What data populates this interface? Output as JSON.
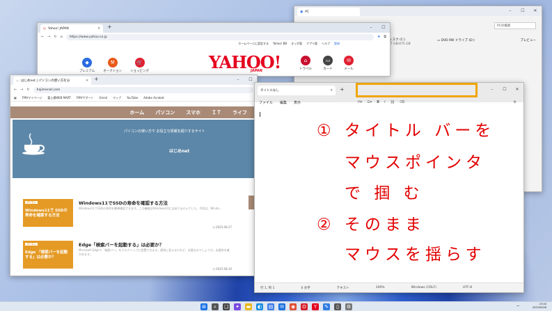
{
  "explorer": {
    "tab": "PC",
    "search_placeholder": "PCの検索",
    "preview": "プレビュー",
    "disk": "ディスク (C:)",
    "disk_free": "197 GB/475 GB",
    "dvd": "DVD RW ドライブ (D:)"
  },
  "yahoo": {
    "tab": "Yahoo! JAPAN",
    "url": "https://www.yahoo.co.jp",
    "top_links": [
      "ホームページに設定する",
      "Yahoo! BB",
      "きっず版",
      "アプリ版",
      "ヘルプ"
    ],
    "signin": "登録",
    "logo": "YAHOO!",
    "logo_sub": "JAPAN",
    "icons": [
      {
        "label": "プレミアム",
        "color": "#2a6be0",
        "icon": "diamond-icon"
      },
      {
        "label": "オークション",
        "color": "#e85a1a",
        "icon": "hammer-icon"
      },
      {
        "label": "ショッピング",
        "color": "#e02030",
        "icon": "cart-icon"
      }
    ],
    "icons_right": [
      {
        "label": "トラベル",
        "color": "#c8102e",
        "icon": "hotel-icon"
      },
      {
        "label": "カード",
        "color": "#444444",
        "icon": "card-icon"
      },
      {
        "label": "メール",
        "color": "#e02030",
        "icon": "mail-icon"
      }
    ]
  },
  "hajime": {
    "tab": "はじめnet | パソコンの使い方を分",
    "url": "hajimenet.com",
    "bookmarks": [
      "FMVマイページ",
      "富士通WEB MART",
      "FMVサポート",
      "Gmail",
      "マップ",
      "YouTube",
      "Adobe Acrobat"
    ],
    "nav": [
      "ホーム",
      "パソコン",
      "スマホ",
      "ＩＴ",
      "ライフ"
    ],
    "tagline": "パソコンの使い方や お役立ち情報を紹介するサイト",
    "site_name": "はじめnet",
    "posts": [
      {
        "badge": "パソコン",
        "thumb": "Windows11で SSDの寿命を確認する方法",
        "title": "Windows11でSSDの寿命を確認する方法",
        "desc": "Windows11でSSDの寿命を簡単確認できます。この機能はWindows10にはありませんでした。今回は、Windo…",
        "date": "2025.08.27"
      },
      {
        "badge": "パソコン",
        "thumb": "Edge 「検索バーを起動する」は必要か？",
        "title": "Edge「検索バーを起動する」は必要か？",
        "desc": "Microsoft Edgeで「検索バー」をデスクトップに設置できます。便利に見えるけれど、必要なのでしょうか。必要性を確かめます。",
        "date": "2025.08.10"
      }
    ]
  },
  "notepad": {
    "tab": "タイトルなし",
    "menus": [
      "ファイル",
      "編集",
      "表示"
    ],
    "status": [
      "行 1, 列 1",
      "0 文字",
      "テキスト",
      "100%",
      "Windows (CRLF)",
      "UTF-8"
    ]
  },
  "instructions": [
    "① タイトル バーを",
    "マウスポインタ",
    "で 掴 む",
    "② そのまま",
    "マウスを揺らす"
  ],
  "colors": {
    "instruction": "#e20000",
    "highlight": "#f0a500"
  },
  "taskbar": {
    "icons": [
      {
        "icon": "windows-icon",
        "color": "#1a73e8"
      },
      {
        "icon": "search-icon",
        "color": "#555555"
      },
      {
        "icon": "taskview-icon",
        "color": "#444444"
      },
      {
        "icon": "copilot-icon",
        "color": "#7a4ae0"
      },
      {
        "icon": "explorer-icon",
        "color": "#e8b923"
      },
      {
        "icon": "edge-icon",
        "color": "#1a8fe0"
      },
      {
        "icon": "store-icon",
        "color": "#3b7be8"
      },
      {
        "icon": "mail-icon",
        "color": "#1a6ee0"
      },
      {
        "icon": "chrome-icon",
        "color": "#e04a2f"
      },
      {
        "icon": "opera-icon",
        "color": "#d61f2c"
      },
      {
        "icon": "yahoo-icon",
        "color": "#e5001e"
      },
      {
        "icon": "notepad-icon",
        "color": "#2f7de1"
      },
      {
        "icon": "phone-icon",
        "color": "#555555"
      },
      {
        "icon": "settings-icon",
        "color": "#777777"
      }
    ],
    "time": "23:40",
    "date": "2025/09/08"
  }
}
